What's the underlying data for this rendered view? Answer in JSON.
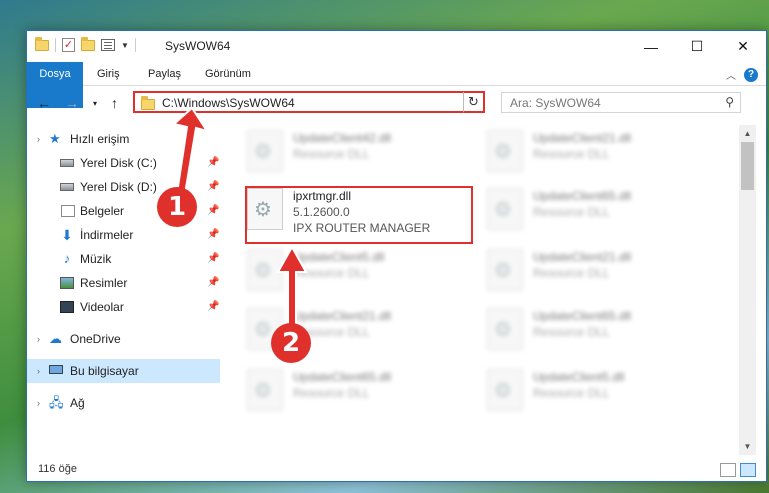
{
  "window": {
    "title": "SysWOW64"
  },
  "ribbon": {
    "tabs": [
      "Dosya",
      "Giriş",
      "Paylaş",
      "Görünüm"
    ]
  },
  "caption": {
    "minimize": "—",
    "maximize": "☐",
    "close": "✕"
  },
  "address": {
    "path": "C:\\Windows\\SysWOW64"
  },
  "search": {
    "placeholder": "Ara: SysWOW64"
  },
  "sidebar": {
    "items": [
      {
        "label": "Hızlı erişim",
        "icon": "star-icon"
      },
      {
        "label": "Yerel Disk (C:)",
        "icon": "disk-icon",
        "pinned": true
      },
      {
        "label": "Yerel Disk (D:)",
        "icon": "disk-icon",
        "pinned": true
      },
      {
        "label": "Belgeler",
        "icon": "documents-icon",
        "pinned": true
      },
      {
        "label": "İndirmeler",
        "icon": "downloads-icon",
        "pinned": true
      },
      {
        "label": "Müzik",
        "icon": "music-icon",
        "pinned": true
      },
      {
        "label": "Resimler",
        "icon": "pictures-icon",
        "pinned": true
      },
      {
        "label": "Videolar",
        "icon": "videos-icon",
        "pinned": true
      },
      {
        "label": "OneDrive",
        "icon": "onedrive-icon"
      },
      {
        "label": "Bu bilgisayar",
        "icon": "computer-icon",
        "selected": true
      },
      {
        "label": "Ağ",
        "icon": "network-icon"
      }
    ]
  },
  "files": {
    "col1": [
      {
        "name": "UpdateClient42.dll",
        "desc": "Resource DLL"
      },
      {
        "name": "UpdateClient5.dll",
        "desc": "Resource DLL"
      },
      {
        "name": "UpdateClient21.dll",
        "desc": "Resource DLL"
      },
      {
        "name": "UpdateClient65.dll",
        "desc": "Resource DLL"
      }
    ],
    "highlighted": {
      "name": "ipxrtmgr.dll",
      "version": "5.1.2600.0",
      "company": "IPX ROUTER MANAGER"
    },
    "col2": [
      {
        "name": "UpdateClient21.dll",
        "desc": "Resource DLL"
      },
      {
        "name": "UpdateClient65.dll",
        "desc": "Resource DLL"
      },
      {
        "name": "UpdateClient21.dll",
        "desc": "Resource DLL"
      },
      {
        "name": "UpdateClient65.dll",
        "desc": "Resource DLL"
      },
      {
        "name": "UpdateClient5.dll",
        "desc": "Resource DLL"
      }
    ]
  },
  "status": {
    "count": "116 öğe"
  },
  "annotations": {
    "badge1": "1",
    "badge2": "2",
    "color": "#e0302c"
  }
}
